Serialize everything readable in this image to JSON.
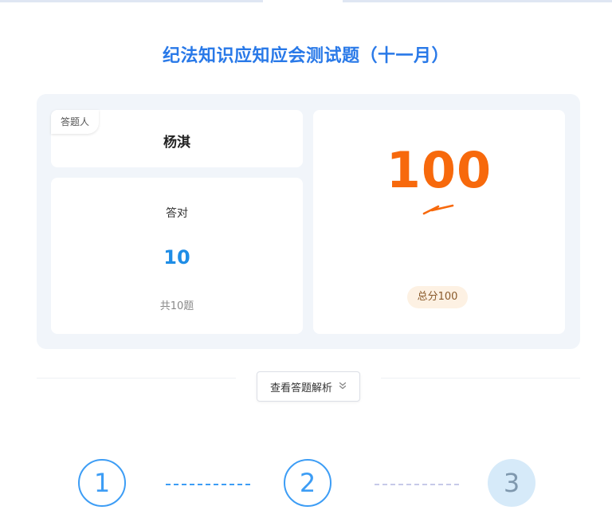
{
  "page": {
    "title": "纪法知识应知应会测试题（十一月）"
  },
  "result": {
    "responder_label": "答题人",
    "responder_name": "杨淇",
    "correct_label": "答对",
    "correct_count": "10",
    "total_text": "共10题",
    "score": "100",
    "total_score_text": "总分100"
  },
  "actions": {
    "view_analysis_label": "查看答题解析",
    "view_analysis_icon": "double-chevron-down-icon"
  },
  "steps": [
    {
      "label": "1",
      "state": "active"
    },
    {
      "label": "2",
      "state": "active"
    },
    {
      "label": "3",
      "state": "inactive"
    }
  ],
  "colors": {
    "title_blue": "#2979e8",
    "score_orange": "#f7690c",
    "correct_blue": "#1f8de6",
    "panel_bg": "#f1f5fa",
    "step_active": "#3d9df5",
    "step_inactive_bg": "#d6eaf9"
  }
}
